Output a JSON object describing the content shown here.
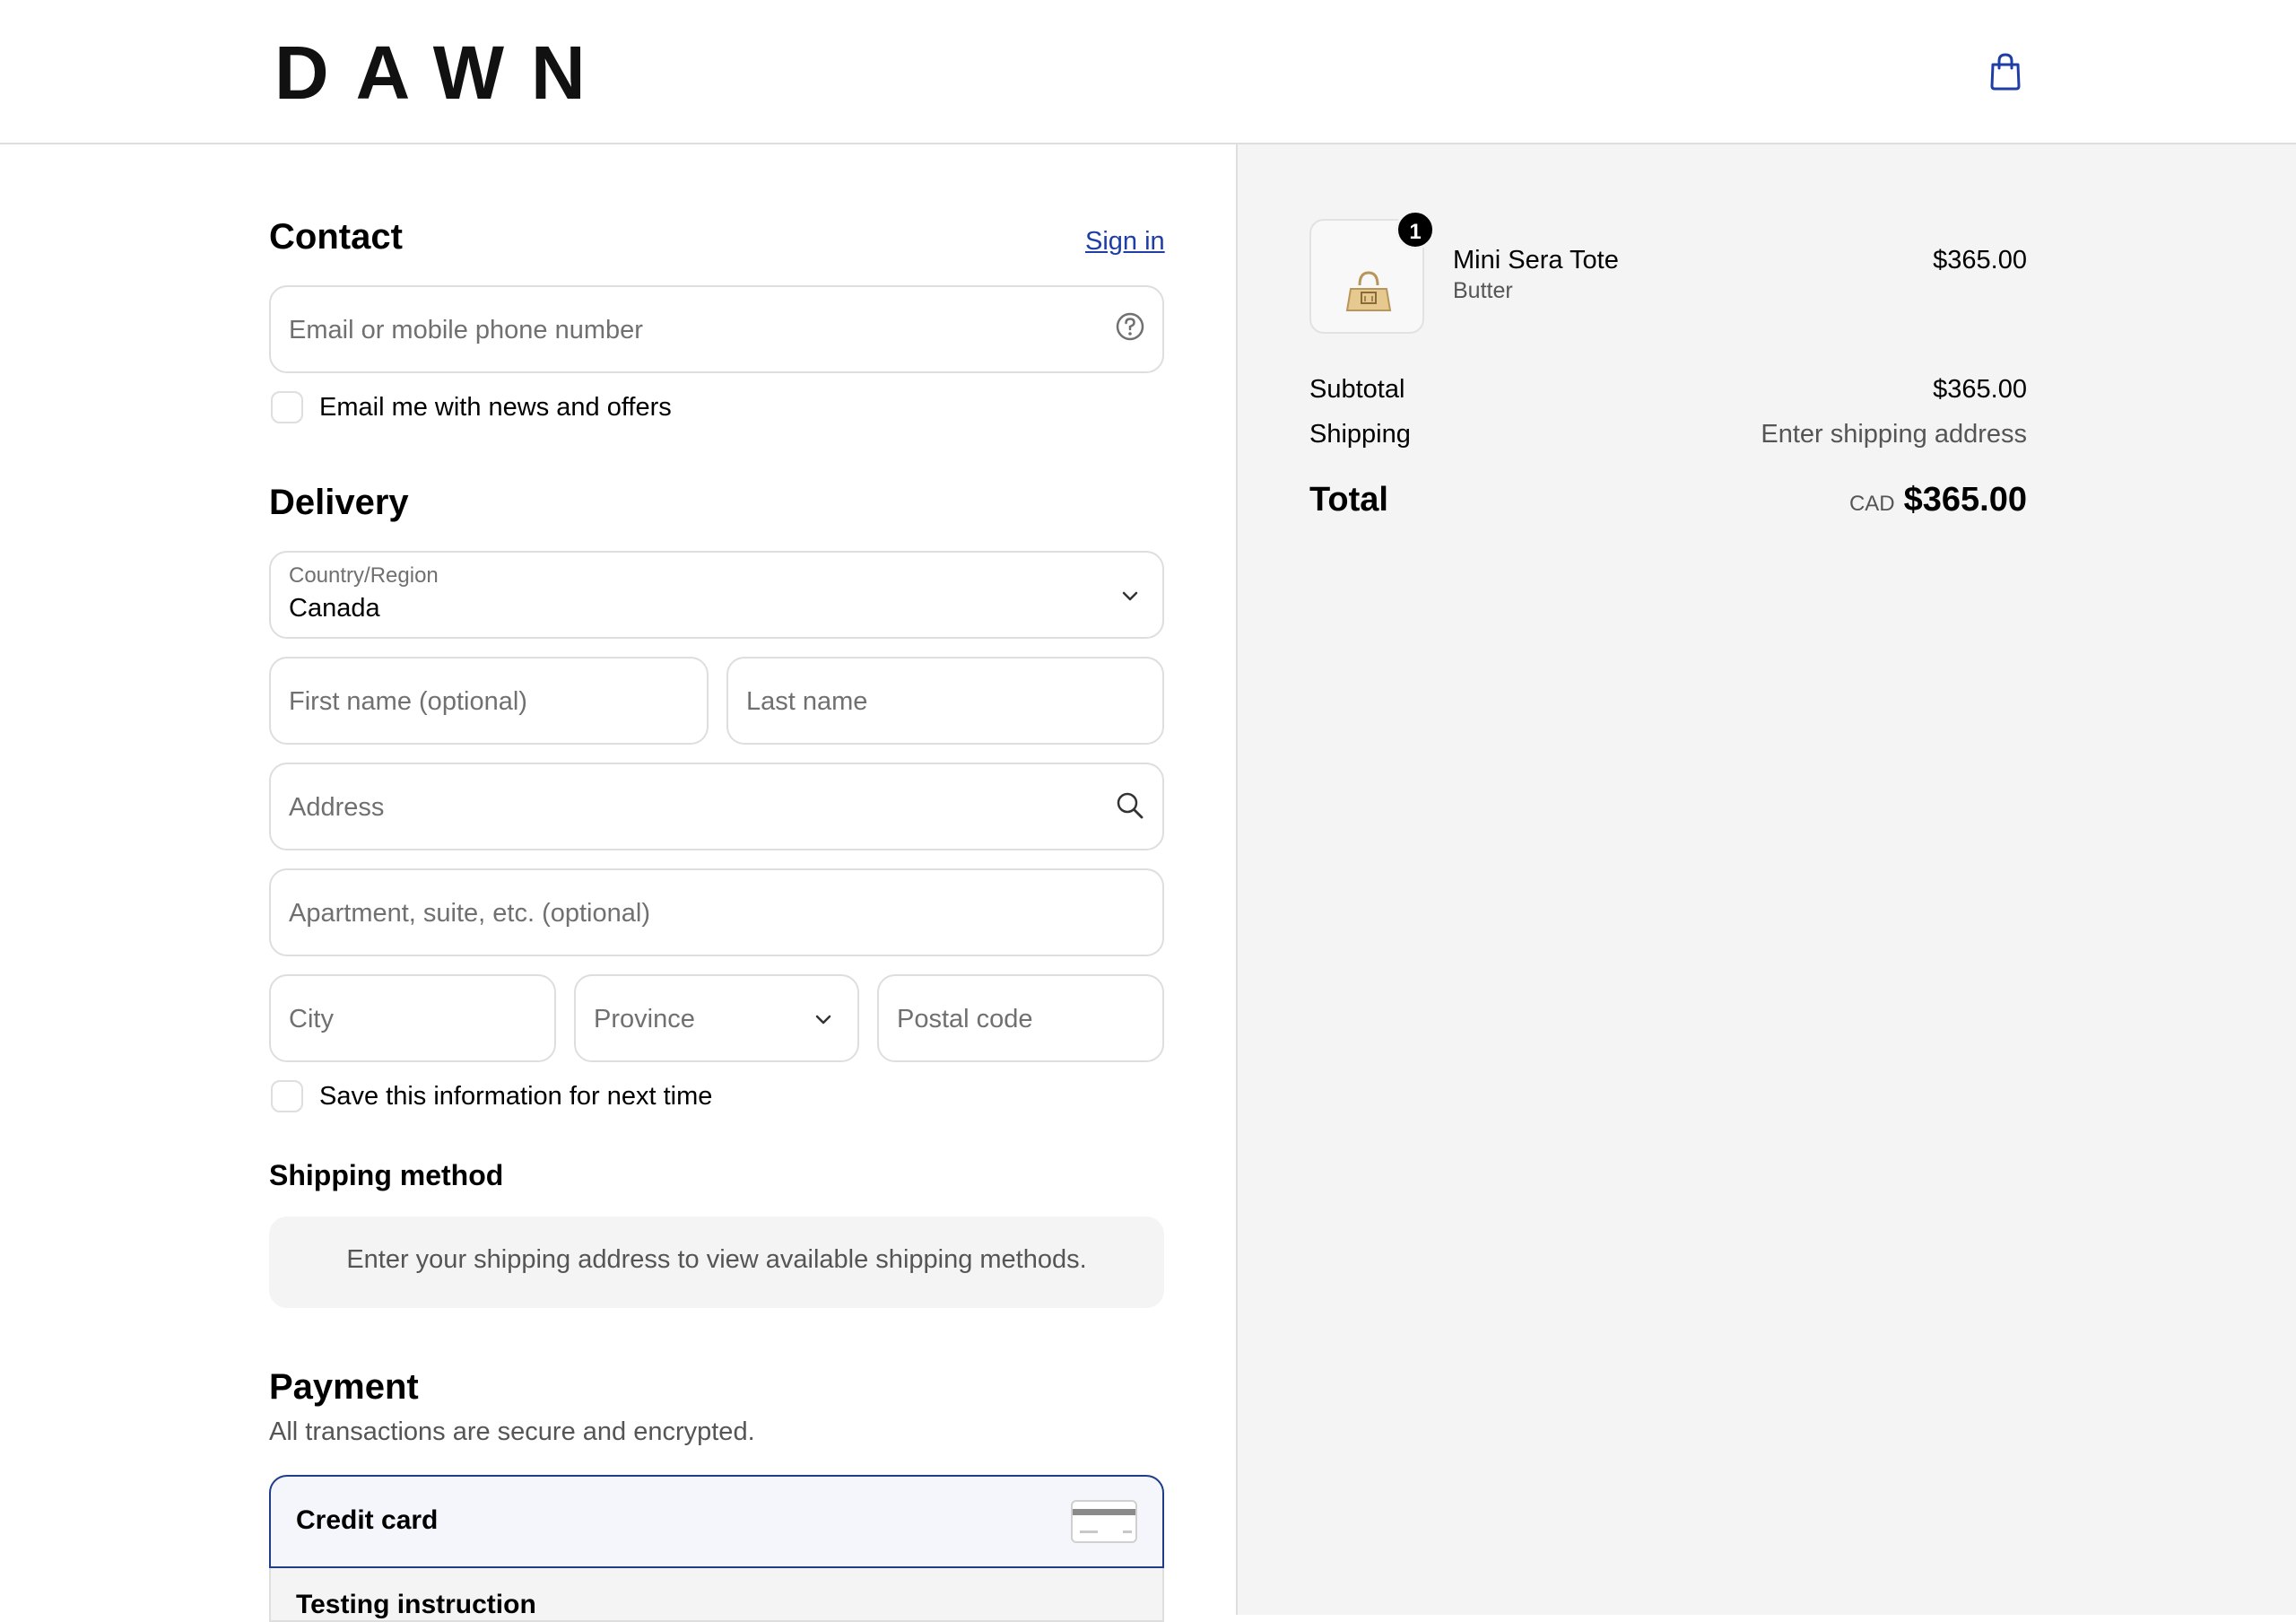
{
  "header": {
    "logo": "DAWN",
    "cart_icon": "shopping-bag-icon"
  },
  "contact": {
    "title": "Contact",
    "sign_in": "Sign in",
    "email_placeholder": "Email or mobile phone number",
    "help_icon": "help-circle-icon",
    "news_label": "Email me with news and offers"
  },
  "delivery": {
    "title": "Delivery",
    "country_label": "Country/Region",
    "country_value": "Canada",
    "first_name": "First name (optional)",
    "last_name": "Last name",
    "address": "Address",
    "apartment": "Apartment, suite, etc. (optional)",
    "city": "City",
    "province": "Province",
    "postal": "Postal code",
    "save_label": "Save this information for next time"
  },
  "shipping_method": {
    "title": "Shipping method",
    "message": "Enter your shipping address to view available shipping methods."
  },
  "payment": {
    "title": "Payment",
    "subtitle": "All transactions are secure and encrypted.",
    "credit_card": "Credit card",
    "testing": "Testing instruction"
  },
  "summary": {
    "product_name": "Mini Sera Tote",
    "product_variant": "Butter",
    "product_price": "$365.00",
    "quantity": "1",
    "subtotal_label": "Subtotal",
    "subtotal_value": "$365.00",
    "shipping_label": "Shipping",
    "shipping_value": "Enter shipping address",
    "total_label": "Total",
    "currency": "CAD",
    "total_value": "$365.00"
  },
  "colors": {
    "accent": "#1f3da6",
    "border": "#dedede",
    "aside_bg": "#f4f4f4"
  }
}
